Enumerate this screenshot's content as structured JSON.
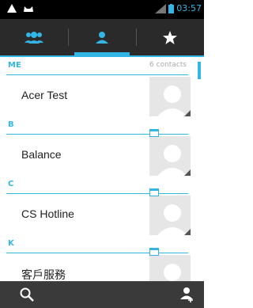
{
  "status_bar": {
    "time": "03:57"
  },
  "tabs": [
    {
      "name": "groups",
      "icon": "group-icon",
      "selected": false
    },
    {
      "name": "all-contacts",
      "icon": "person-icon",
      "selected": true
    },
    {
      "name": "favorites",
      "icon": "star-icon",
      "selected": false
    }
  ],
  "sections": [
    {
      "letter": "ME",
      "count": "6 contacts",
      "contacts": [
        {
          "name": "Acer Test"
        }
      ]
    },
    {
      "letter": "B",
      "contacts": [
        {
          "name": "Balance"
        }
      ]
    },
    {
      "letter": "C",
      "contacts": [
        {
          "name": "CS Hotline"
        }
      ]
    },
    {
      "letter": "K",
      "contacts": [
        {
          "name": "客戶服務"
        }
      ]
    }
  ],
  "bottom_bar": {
    "search_icon": "search-icon",
    "add_icon": "add-contact-icon"
  },
  "colors": {
    "accent": "#33b5e5",
    "bar": "#2a2a2a"
  }
}
